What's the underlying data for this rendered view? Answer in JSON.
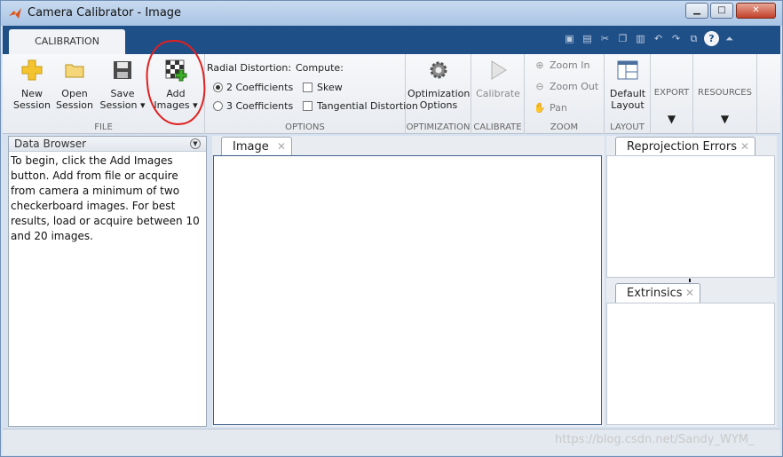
{
  "window": {
    "title": "Camera Calibrator - Image",
    "minimize_label": "▁",
    "maximize_label": "□",
    "close_label": "✕"
  },
  "toolstrip": {
    "tab_label": "CALIBRATION"
  },
  "quick_access": [
    "new-file-icon",
    "save-icon",
    "cut-icon",
    "copy-icon",
    "paste-icon",
    "undo-icon",
    "redo-icon",
    "switch-windows-icon",
    "help-icon",
    "collapse-icon"
  ],
  "ribbon": {
    "file": {
      "label": "FILE",
      "new_session": [
        "New",
        "Session"
      ],
      "open_session": [
        "Open",
        "Session"
      ],
      "save_session": [
        "Save",
        "Session ▾"
      ],
      "add_images": [
        "Add",
        "Images ▾"
      ]
    },
    "options": {
      "label": "OPTIONS",
      "radial_label": "Radial Distortion:",
      "compute_label": "Compute:",
      "two_coeff": "2 Coefficients",
      "three_coeff": "3 Coefficients",
      "skew": "Skew",
      "tangential": "Tangential Distortion"
    },
    "optimization": {
      "label": "OPTIMIZATION",
      "button": [
        "Optimization",
        "Options"
      ]
    },
    "calibrate": {
      "label": "CALIBRATE",
      "button": "Calibrate"
    },
    "zoom": {
      "label": "ZOOM",
      "zoom_in": "Zoom In",
      "zoom_out": "Zoom Out",
      "pan": "Pan"
    },
    "layout": {
      "label": "LAYOUT",
      "button": [
        "Default",
        "Layout"
      ]
    },
    "export": {
      "label": "EXPORT"
    },
    "resources": {
      "label": "RESOURCES"
    }
  },
  "data_browser": {
    "title": "Data Browser",
    "lines": [
      "To begin, click the Add Images",
      "button. Add from file or acquire",
      "from camera a minimum of two",
      "checkerboard images. For best",
      "results, load or acquire between 10",
      "and 20 images."
    ]
  },
  "tabs": {
    "image": "Image",
    "reprojection": "Reprojection Errors",
    "extrinsics": "Extrinsics",
    "close_glyph": "✕"
  },
  "watermark": "https://blog.csdn.net/Sandy_WYM_"
}
